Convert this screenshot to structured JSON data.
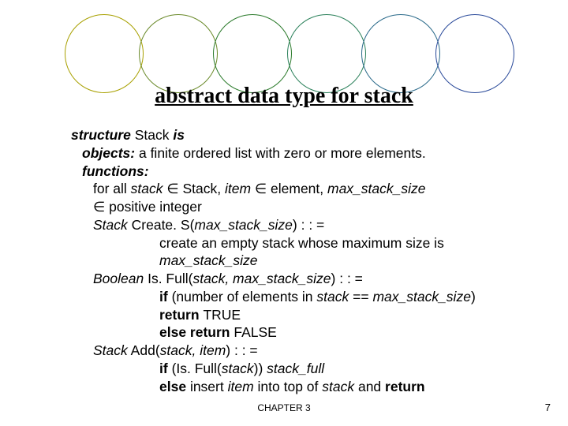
{
  "title": "abstract data type for stack",
  "lines": {
    "l1a": "structure",
    "l1b": " Stack ",
    "l1c": "is",
    "l2a": "objects:",
    "l2b": " a finite ordered list with zero or more elements.",
    "l3": "functions:",
    "l4a": "for all ",
    "l4b": "stack",
    "l4c": " ∈ Stack, ",
    "l4d": "item",
    "l4e": " ∈ element, ",
    "l4f": "max_stack_size",
    "l5": "∈ positive integer",
    "l6a": "Stack",
    "l6b": " Create. S(",
    "l6c": "max_stack_size",
    "l6d": ") : : =",
    "l7": "create an empty stack whose maximum size is",
    "l8": "max_stack_size",
    "l9a": "Boolean",
    "l9b": " Is. Full(",
    "l9c": "stack, max_stack_size",
    "l9d": ") : : =",
    "l10a": "if",
    "l10b": " (number of elements in ",
    "l10c": "stack",
    "l10d": " == ",
    "l10e": "max_stack_size",
    "l10f": ")",
    "l11a": "return ",
    "l11b": "TRUE",
    "l12a": "else return ",
    "l12b": "FALSE",
    "l13a": "Stack",
    "l13b": " Add(",
    "l13c": "stack, item",
    "l13d": ") : : =",
    "l14a": "if",
    "l14b": " (Is. Full(",
    "l14c": "stack",
    "l14d": ")) ",
    "l14e": "stack_full",
    "l15a": "else ",
    "l15b": "insert ",
    "l15c": "item",
    "l15d": " into top of ",
    "l15e": "stack",
    "l15f": " and ",
    "l15g": "return"
  },
  "footer": {
    "chapter": "CHAPTER 3",
    "page": "7"
  }
}
